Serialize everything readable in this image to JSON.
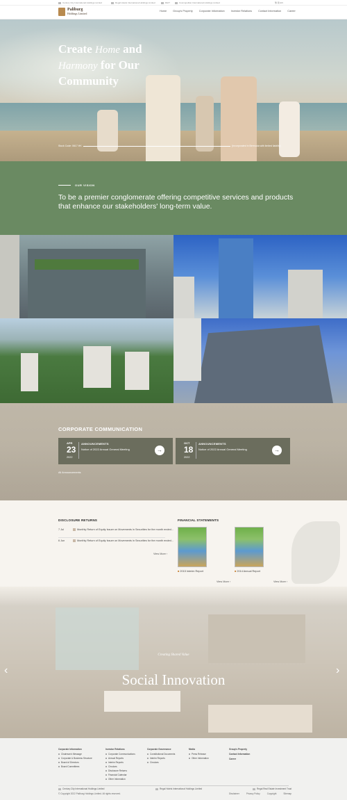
{
  "topbar": {
    "links": [
      "Century City International Holdings Limited",
      "Regal Hotels International Holdings Limited",
      "RHIT",
      "Cosmopolitan International Holdings Limited"
    ],
    "lang": "繁 简 EN"
  },
  "header": {
    "logo_line1": "Paliburg",
    "logo_line2": "Holdings Limited",
    "nav": [
      "Home",
      "Group's Property",
      "Corporate Information",
      "Investor Relations",
      "Contact Information",
      "Career"
    ]
  },
  "hero": {
    "title_line1_a": "Create ",
    "title_line1_script": "Home",
    "title_line1_b": " and",
    "title_line2_script": "Harmony",
    "title_line2_b": " for Our",
    "title_line3": "Community",
    "stock_code": "Stock Code: 0617.HK",
    "incorporation": "(Incorporated in Bermuda with limited liability)"
  },
  "vision": {
    "label": "OUR VISION",
    "text": "To be a premier conglomerate offering competitive services and products that enhance our stakeholders' long-term value."
  },
  "corporate_communication": {
    "title": "CORPORATE COMMUNICATION",
    "cards": [
      {
        "month": "APR",
        "day": "23",
        "year": "2022",
        "category": "ANNOUNCEMENTS",
        "title": "Notice of 2022 Annual General Meeting"
      },
      {
        "month": "OCT",
        "day": "18",
        "year": "2022",
        "category": "ANNOUNCEMENTS",
        "title": "Notice of 2022 Annual General Meeting"
      }
    ],
    "all_link": "All Announcements"
  },
  "disclosure": {
    "title": "DISCLOSURE RETURNS",
    "rows": [
      {
        "date": "7 Jul",
        "text": "Monthly Return of Equity Issuer on Movements in Securities for the month ended..."
      },
      {
        "date": "6 Jun",
        "text": "Monthly Return of Equity Issuer on Movements in Securities for the month ended..."
      }
    ],
    "more": "View More ›"
  },
  "financial": {
    "title": "FINANCIAL STATEMENTS",
    "reports": [
      "2015 Interim Report",
      "2014 Annual Report"
    ],
    "more": "View More ›"
  },
  "social": {
    "subtitle": "Creating Shared Value",
    "title": "Social Innovation"
  },
  "footer": {
    "columns": [
      {
        "heading": "Corporate Information",
        "items": [
          "Chairman's Message",
          "Corporate & Business Structure",
          "Board of Directors",
          "Board Committees"
        ]
      },
      {
        "heading": "Investor Relations",
        "items": [
          "Corporate Communications",
          "Annual Reports",
          "Interim Reports",
          "Circulars",
          "Disclosure Returns",
          "Financial Calendar",
          "Other Information"
        ]
      },
      {
        "heading": "Corporate Governance",
        "items": [
          "Constitutional Documents",
          "Interim Reports",
          "Circulars"
        ]
      },
      {
        "heading": "Media",
        "items": [
          "Press Release",
          "Other Information"
        ]
      },
      {
        "heading": "Group's Property",
        "items": []
      },
      {
        "heading": "Contact Information",
        "items": []
      },
      {
        "heading": "Career",
        "items": []
      }
    ],
    "companies": [
      "Century City International Holdings Limited",
      "Regal Hotels International Holdings Limited",
      "Regal Real Estate Investment Trust"
    ],
    "copyright": "© Copyright 2022 Paliburg Holdings Limited. All rights reserved.",
    "links": [
      "Disclaimer",
      "Privacy Policy",
      "Copyright",
      "Sitemap"
    ]
  }
}
